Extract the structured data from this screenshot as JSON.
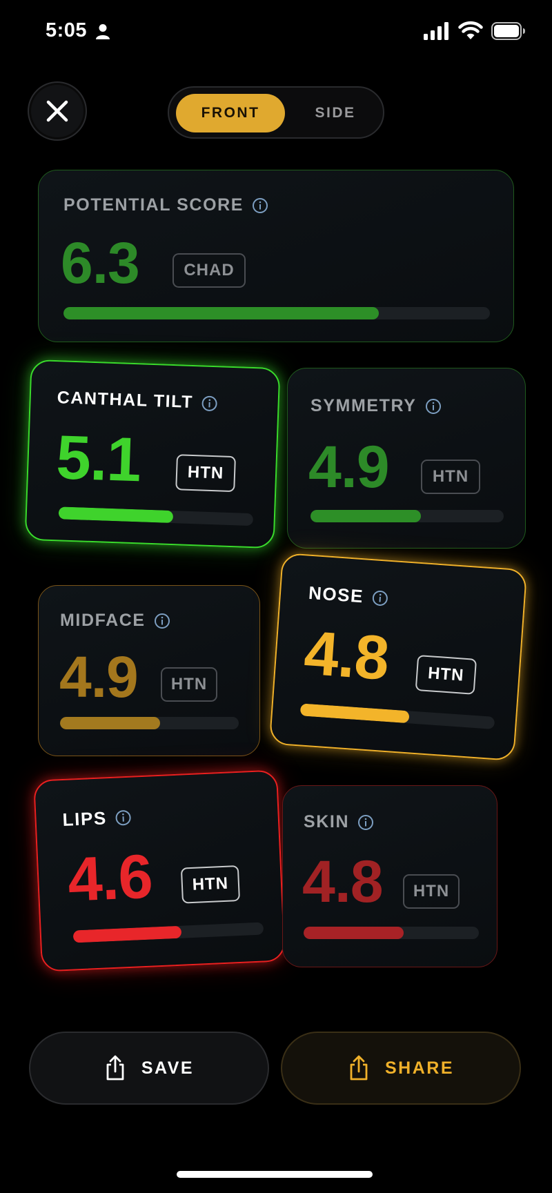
{
  "status_bar": {
    "time": "5:05"
  },
  "segmented": {
    "front_label": "FRONT",
    "side_label": "SIDE",
    "selected": "FRONT"
  },
  "colors": {
    "accent": "#e0a92f",
    "green": "#3fd32c",
    "green_dim": "#2d8a28",
    "amber": "#f3b42a",
    "amber_dim": "#a4771d",
    "red": "#e8262a",
    "red_dim": "#a12224"
  },
  "cards": {
    "potential": {
      "title": "POTENTIAL SCORE",
      "score": "6.3",
      "badge": "CHAD",
      "progress": 0.74
    },
    "canthal": {
      "title": "CANTHAL TILT",
      "score": "5.1",
      "badge": "HTN",
      "progress": 0.59
    },
    "symmetry": {
      "title": "SYMMETRY",
      "score": "4.9",
      "badge": "HTN",
      "progress": 0.57
    },
    "midface": {
      "title": "MIDFACE",
      "score": "4.9",
      "badge": "HTN",
      "progress": 0.56
    },
    "nose": {
      "title": "NOSE",
      "score": "4.8",
      "badge": "HTN",
      "progress": 0.56
    },
    "lips": {
      "title": "LIPS",
      "score": "4.6",
      "badge": "HTN",
      "progress": 0.57
    },
    "skin": {
      "title": "SKIN",
      "score": "4.8",
      "badge": "HTN",
      "progress": 0.57
    }
  },
  "buttons": {
    "save_label": "SAVE",
    "share_label": "SHARE"
  },
  "icons": {
    "close": "close-icon",
    "info": "info-icon",
    "save": "share-out-icon",
    "share": "share-out-icon"
  }
}
